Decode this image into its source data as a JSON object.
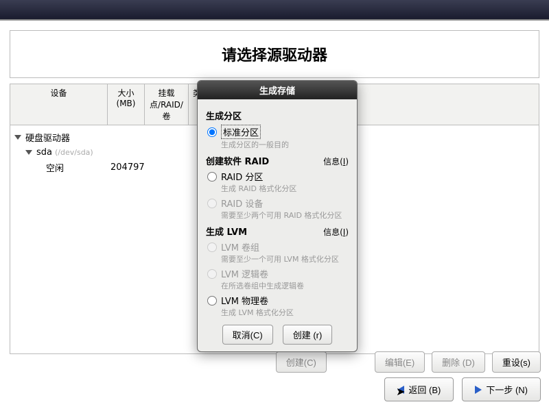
{
  "title": "请选择源驱动器",
  "columns": {
    "device": "设备",
    "size": "大小(MB)",
    "mount": "挂载点/RAID/卷",
    "type": "类"
  },
  "tree": {
    "root": "硬盘驱动器",
    "sda_label": "sda",
    "sda_path": "(/dev/sda)",
    "free_label": "空闲",
    "free_size": "204797"
  },
  "lower_buttons": {
    "create": "创建(C)",
    "edit": "编辑(E)",
    "delete": "删除 (D)",
    "reset": "重设(s)"
  },
  "nav": {
    "back": "返回 (B)",
    "next": "下一步 (N)"
  },
  "dialog": {
    "title": "生成存储",
    "sec1_head": "生成分区",
    "opt1": "标准分区",
    "opt1_desc": "生成分区的一般目的",
    "sec2_head": "创建软件 RAID",
    "info_label": "信息(",
    "info_key": "I",
    "info_close": ")",
    "opt2": "RAID 分区",
    "opt2_desc": "生成 RAID 格式化分区",
    "opt3": "RAID 设备",
    "opt3_desc": "需要至少两个可用 RAID 格式化分区",
    "sec3_head": "生成 LVM",
    "opt4": "LVM 卷组",
    "opt4_desc": "需要至少一个可用 LVM 格式化分区",
    "opt5": "LVM 逻辑卷",
    "opt5_desc": "在所选卷组中生成逻辑卷",
    "opt6": "LVM 物理卷",
    "opt6_desc": "生成 LVM 格式化分区",
    "cancel": "取消(C)",
    "create": "创建 (r)"
  }
}
